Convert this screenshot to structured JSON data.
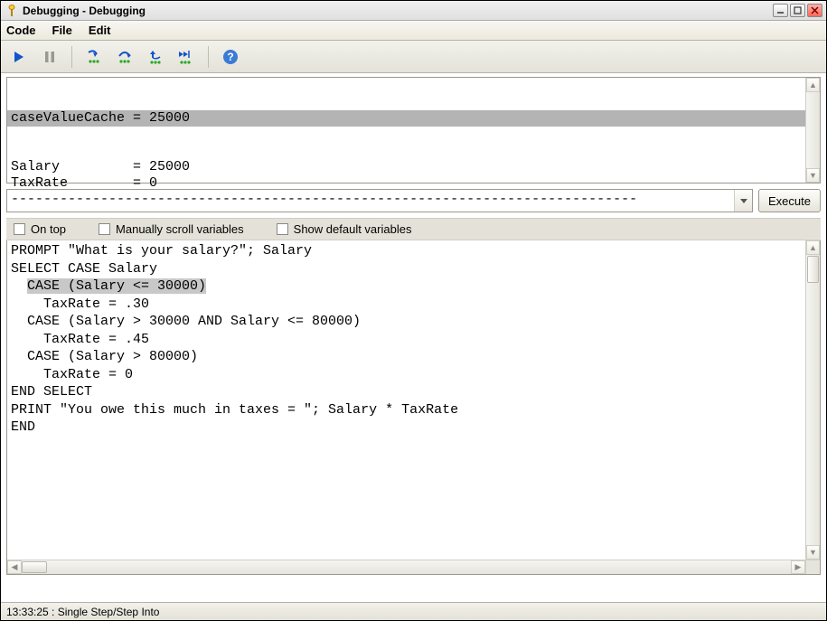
{
  "window": {
    "title": "Debugging - Debugging"
  },
  "menu": {
    "code": "Code",
    "file": "File",
    "edit": "Edit"
  },
  "toolbar": {
    "run": "run-icon",
    "pause": "pause-icon",
    "step_into": "step-into-icon",
    "step_over": "step-over-icon",
    "step_out": "step-out-icon",
    "run_to": "run-to-icon",
    "help": "help-icon"
  },
  "variables": {
    "highlighted": "caseValueCache = 25000",
    "lines": [
      "Salary         = 25000",
      "TaxRate        = 0",
      "-----------------------------------------------------------------------------"
    ]
  },
  "command": {
    "value": "",
    "execute_label": "Execute"
  },
  "options": {
    "on_top": {
      "label": "On top",
      "checked": false
    },
    "manual_scroll": {
      "label": "Manually scroll variables",
      "checked": false
    },
    "show_default": {
      "label": "Show default variables",
      "checked": false
    }
  },
  "code": {
    "lines": [
      "PROMPT \"What is your salary?\"; Salary",
      "SELECT CASE Salary",
      "  CASE (Salary <= 30000)",
      "    TaxRate = .30",
      "  CASE (Salary > 30000 AND Salary <= 80000)",
      "    TaxRate = .45",
      "  CASE (Salary > 80000)",
      "    TaxRate = 0",
      "END SELECT",
      "PRINT \"You owe this much in taxes = \"; Salary * TaxRate",
      "END"
    ],
    "current_line_index": 2
  },
  "status": {
    "text": "13:33:25 : Single Step/Step Into"
  }
}
